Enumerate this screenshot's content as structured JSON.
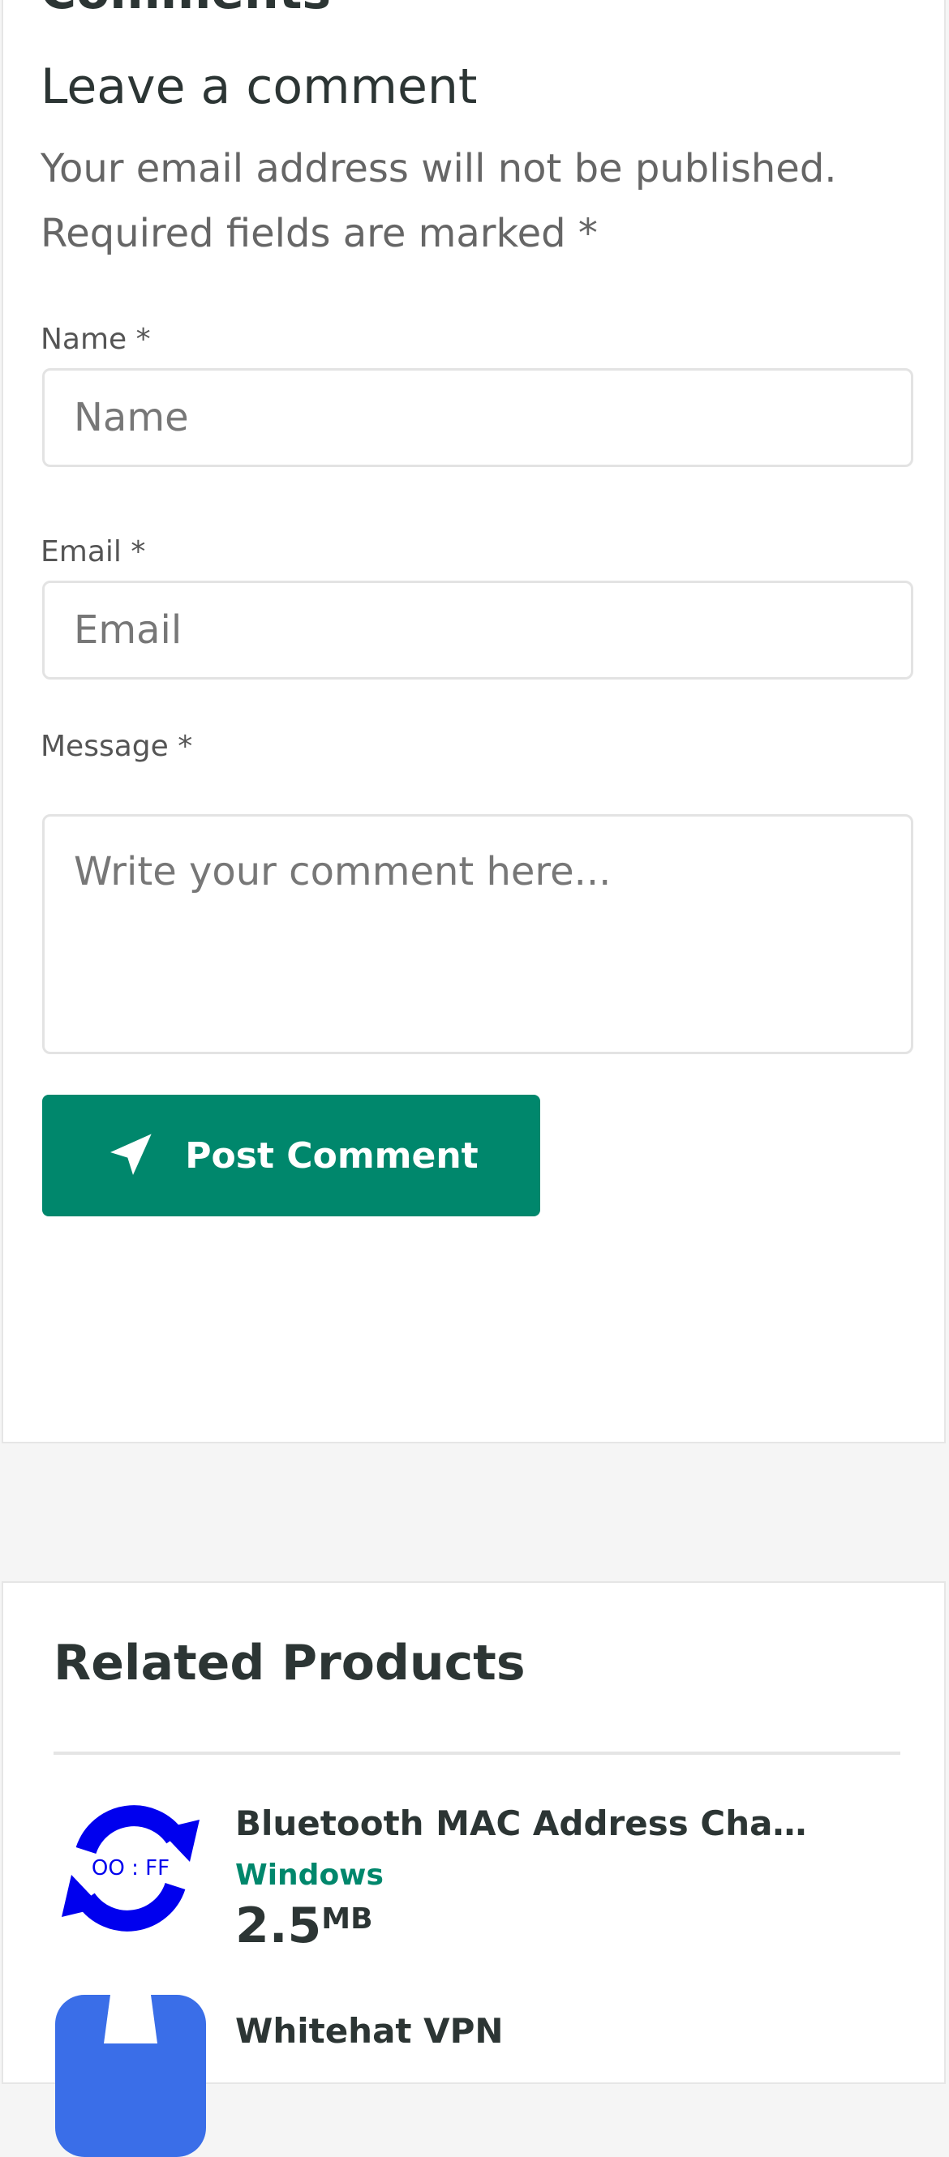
{
  "comments": {
    "heading": "Comments",
    "form_title": "Leave a comment",
    "notice": "Your email address will not be published. Required fields are marked *",
    "name_label": "Name *",
    "name_placeholder": "Name",
    "email_label": "Email *",
    "email_placeholder": "Email",
    "message_label": "Message *",
    "message_placeholder": "Write your comment here...",
    "submit_label": "Post Comment"
  },
  "related": {
    "title": "Related Products",
    "items": [
      {
        "name": "Bluetooth MAC Address Changer",
        "platform": "Windows",
        "size": "2.5",
        "unit": "MB",
        "icon": "refresh-mac-icon",
        "icon_text": "OO : FF"
      },
      {
        "name": "Whitehat VPN",
        "icon": "vpn-icon"
      }
    ]
  },
  "colors": {
    "accent": "#00876c",
    "background": "#f5f5f5",
    "card": "#ffffff",
    "text": "#2c3534",
    "icon_blue": "#0000ee",
    "vpn_blue": "#3a6ee8"
  }
}
